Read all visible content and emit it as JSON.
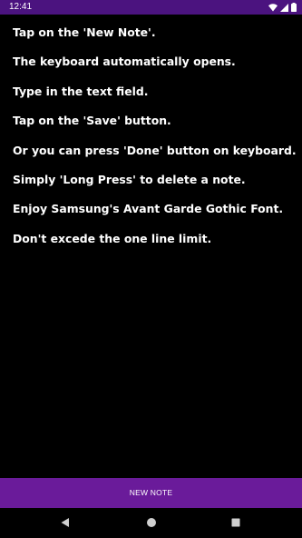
{
  "status_bar": {
    "time": "12:41",
    "background": "#4b137f",
    "icons": [
      "wifi-icon",
      "signal-icon",
      "battery-icon"
    ]
  },
  "instructions": [
    "Tap on the 'New Note'.",
    "The keyboard automatically opens.",
    "Type in the text field.",
    "Tap on the 'Save' button.",
    "Or you can press 'Done' button on keyboard.",
    "Simply 'Long Press' to delete a note.",
    "Enjoy Samsung's Avant Garde Gothic Font.",
    "Don't excede the one line limit."
  ],
  "new_note_button": {
    "label": "NEW NOTE",
    "color": "#6a1b9a"
  },
  "nav_bar": {
    "icons": [
      "back-icon",
      "home-icon",
      "recents-icon"
    ]
  }
}
